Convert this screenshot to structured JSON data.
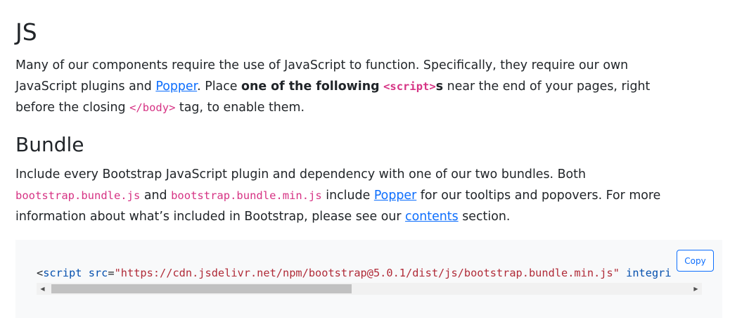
{
  "sections": {
    "js": {
      "title": "JS",
      "para": {
        "l1": "Many of our components require the use of JavaScript to function. Specifically, they require our own",
        "l2_a": "JavaScript plugins and ",
        "l2_link": "Popper",
        "l2_b": ". Place ",
        "l2_strong": "one of the following",
        "l2_code": "<script>",
        "l2_s": "s",
        "l2_c": " near the end of your pages, right",
        "l3_a": "before the closing ",
        "l3_code": "</body>",
        "l3_b": " tag, to enable them."
      }
    },
    "bundle": {
      "title": "Bundle",
      "para": {
        "l1": "Include every Bootstrap JavaScript plugin and dependency with one of our two bundles. Both",
        "l2_code1": "bootstrap.bundle.js",
        "l2_and": " and ",
        "l2_code2": "bootstrap.bundle.min.js",
        "l2_include": " include ",
        "l2_link": "Popper",
        "l2_rest": " for our tooltips and popovers. For more",
        "l3_a": "information about what’s included in Bootstrap, please see our ",
        "l3_link": "contents",
        "l3_b": " section."
      }
    }
  },
  "code_block": {
    "tag_open": "<",
    "tag_name": "script",
    "space1": " ",
    "attr1": "src",
    "eq": "=",
    "src_value": "\"https://cdn.jsdelivr.net/npm/bootstrap@5.0.1/dist/js/bootstrap.bundle.min.js\"",
    "space2": " ",
    "attr2_partial": "integri",
    "copy_label": "Copy"
  },
  "scrollbar": {
    "left_arrow": "◀",
    "right_arrow": "▶",
    "thumb_fraction": 0.45
  },
  "colors": {
    "link": "#0d6efd",
    "code": "#d63384",
    "code_bg": "#f8f9fa"
  }
}
